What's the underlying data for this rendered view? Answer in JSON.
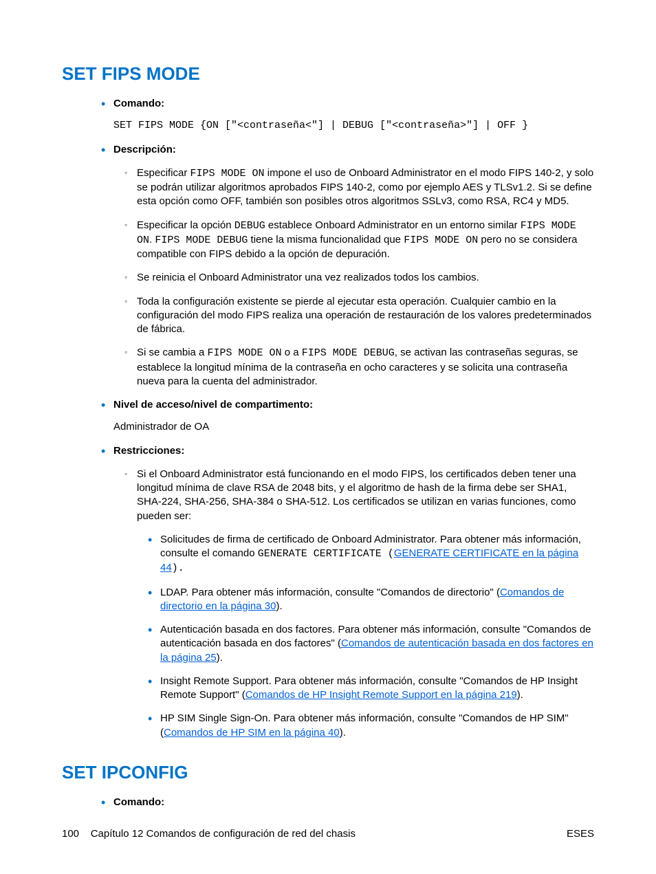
{
  "section1": {
    "title": "SET FIPS MODE",
    "comando_label": "Comando:",
    "comando_code": "SET FIPS MODE {ON [\"<contraseña<\"] | DEBUG [\"<contraseña>\"] | OFF }",
    "descripcion_label": "Descripción:",
    "desc_items": {
      "d1_pre": "Especificar ",
      "d1_code": "FIPS MODE ON",
      "d1_post": " impone el uso de Onboard Administrator en el modo FIPS 140-2, y solo se podrán utilizar algoritmos aprobados FIPS 140-2, como por ejemplo AES y TLSv1.2. Si se define esta opción como OFF, también son posibles otros algoritmos SSLv3, como RSA, RC4 y MD5.",
      "d2_a": "Especificar la opción ",
      "d2_code1": "DEBUG",
      "d2_b": " establece Onboard Administrator en un entorno similar ",
      "d2_code2": "FIPS MODE ON",
      "d2_c": ". ",
      "d2_code3": "FIPS MODE DEBUG",
      "d2_d": " tiene la misma funcionalidad que ",
      "d2_code4": "FIPS MODE ON",
      "d2_e": " pero no se considera compatible con FIPS debido a la opción de depuración.",
      "d3": "Se reinicia el Onboard Administrator una vez realizados todos los cambios.",
      "d4": "Toda la configuración existente se pierde al ejecutar esta operación. Cualquier cambio en la configuración del modo FIPS realiza una operación de restauración de los valores predeterminados de fábrica.",
      "d5_a": "Si se cambia a ",
      "d5_code1": "FIPS MODE ON",
      "d5_b": " o a ",
      "d5_code2": "FIPS MODE DEBUG",
      "d5_c": ", se activan las contraseñas seguras, se establece la longitud mínima de la contraseña en ocho caracteres y se solicita una contraseña nueva para la cuenta del administrador."
    },
    "nivel_label": "Nivel de acceso/nivel de compartimento:",
    "nivel_value": "Administrador de OA",
    "restricciones_label": "Restricciones:",
    "rest_intro": "Si el Onboard Administrator está funcionando en el modo FIPS, los certificados deben tener una longitud mínima de clave RSA de 2048 bits, y el algoritmo de hash de la firma debe ser SHA1, SHA-224, SHA-256, SHA-384 o SHA-512. Los certificados se utilizan en varias funciones, como pueden ser:",
    "rest_items": {
      "r1_a": "Solicitudes de firma de certificado de Onboard Administrator. Para obtener más información, consulte el comando ",
      "r1_code": "GENERATE CERTIFICATE",
      "r1_paren_open": " (",
      "r1_link": "GENERATE CERTIFICATE en la página 44",
      "r1_paren_close": ").",
      "r2_a": "LDAP. Para obtener más información, consulte \"Comandos de directorio\" (",
      "r2_link": "Comandos de directorio en la página 30",
      "r2_b": ").",
      "r3_a": "Autenticación basada en dos factores. Para obtener más información, consulte \"Comandos de autenticación basada en dos factores\" (",
      "r3_link": "Comandos de autenticación basada en dos factores en la página 25",
      "r3_b": ").",
      "r4_a": "Insight Remote Support. Para obtener más información, consulte \"Comandos de HP Insight Remote Support\" (",
      "r4_link": "Comandos de HP Insight Remote Support en la página 219",
      "r4_b": ").",
      "r5_a": "HP SIM Single Sign-On. Para obtener más información, consulte \"Comandos de HP SIM\" (",
      "r5_link": "Comandos de HP SIM en la página 40",
      "r5_b": ")."
    }
  },
  "section2": {
    "title": "SET IPCONFIG",
    "comando_label": "Comando:"
  },
  "footer": {
    "left_page": "100",
    "left_chapter": "Capítulo 12   Comandos de configuración de red del chasis",
    "right": "ESES"
  }
}
